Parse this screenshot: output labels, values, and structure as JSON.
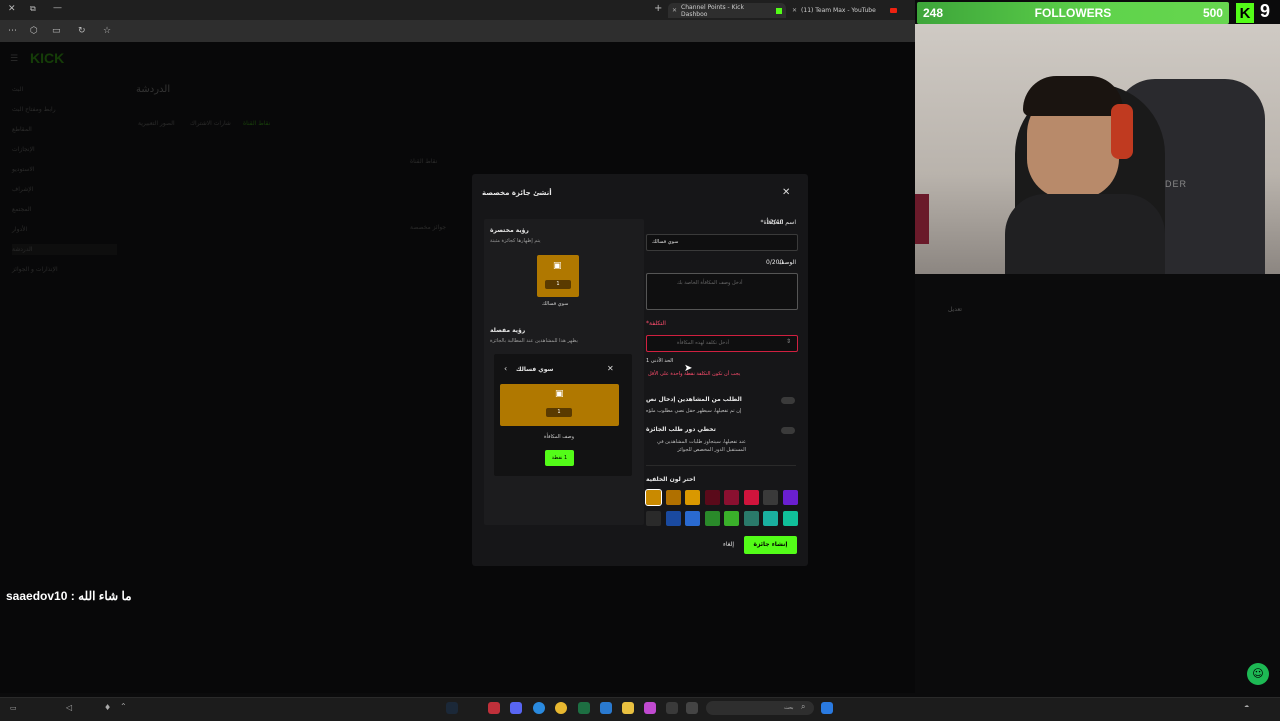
{
  "browser": {
    "tabs": [
      {
        "title": "Channel Points - Kick Dashboo",
        "active": true
      },
      {
        "title": "(11) Team Max - YouTube",
        "active": false
      }
    ]
  },
  "kick": {
    "logo": "KICK",
    "page_title": "الدردشة",
    "tabs": [
      "نقاط القناة",
      "شارات الاشتراك",
      "الصور التعبيرية"
    ],
    "sidebar": [
      "البث",
      "رابط ومفتاح البث",
      "المقاطع",
      "الإنجازات",
      "الاستوديو",
      "الإشراف",
      "المجتمع",
      "الأدوار",
      "الدردشة",
      "الإنذارات و الجوائز"
    ],
    "bg_section_title": "نقاط القناة",
    "bg_section_sub": "جوائز مخصصة",
    "bg_edit": "تعديل"
  },
  "modal": {
    "title": "أنشئ جائزة مخصصة",
    "preview_short_title": "رؤية مختصرة",
    "preview_short_desc": "يتم إظهارها كجائزة مثبتة",
    "reward_cost": "1",
    "reward_name_preview": "سوي فسالك",
    "preview_full_title": "رؤية مفصلة",
    "preview_full_desc": "يظهر هذا للمشاهدين عند المطالبة بالجائزة",
    "detail_card_name": "سوي فسالك",
    "detail_card_desc": "وصف المكافأة",
    "detail_button": "1 نقطة",
    "name_label": "اسم المكافأة*",
    "name_counter": "12/40",
    "name_value": "سوي فسالك",
    "desc_label": "الوصف",
    "desc_counter": "0/200",
    "desc_placeholder": "أدخل وصف المكافأة الخاصة بك",
    "cost_label": "التكلفة*",
    "cost_placeholder": "أدخل تكلفة لهذه المكافأة",
    "cost_min": "الحد الأدنى 1",
    "cost_error": "يجب أن تكون التكلفة نقطة واحدة على الأقل",
    "toggle1_label": "الطلب من المشاهدين إدخال نص",
    "toggle1_desc": "إن تم تفعيلها، سيظهر حقل نصي مطلوب ملؤه",
    "toggle2_label": "تخطي دور طلب الجائزة",
    "toggle2_desc": "عند تفعيلها، سيتجاوز طلبات المشاهدين في المستقبل الدور المخصص للجوائز",
    "color_label": "اختر لون الخلفية",
    "colors_row1": [
      "#c98a00",
      "#b07000",
      "#d99800",
      "#5a0a1a",
      "#8a1030",
      "#d0143c",
      "#3a3a3a",
      "#6a1fd0"
    ],
    "colors_row2": [
      "#2a2a2a",
      "#1a4aa0",
      "#2a6ad0",
      "#2a8a2a",
      "#3ab02a",
      "#2a7a6a",
      "#1ab0a0",
      "#10c09a"
    ],
    "cancel_label": "إلغاء",
    "create_label": "إنشاء جائزة"
  },
  "overlay": {
    "followers_current": "248",
    "followers_label": "FOLLOWERS",
    "followers_goal": "500",
    "kick_count": "9",
    "cam_brand": "LEADER",
    "chat_user": "saaedov10",
    "chat_sep": " : ",
    "chat_msg": "ما شاء الله"
  },
  "taskbar": {
    "search": "بحث"
  }
}
